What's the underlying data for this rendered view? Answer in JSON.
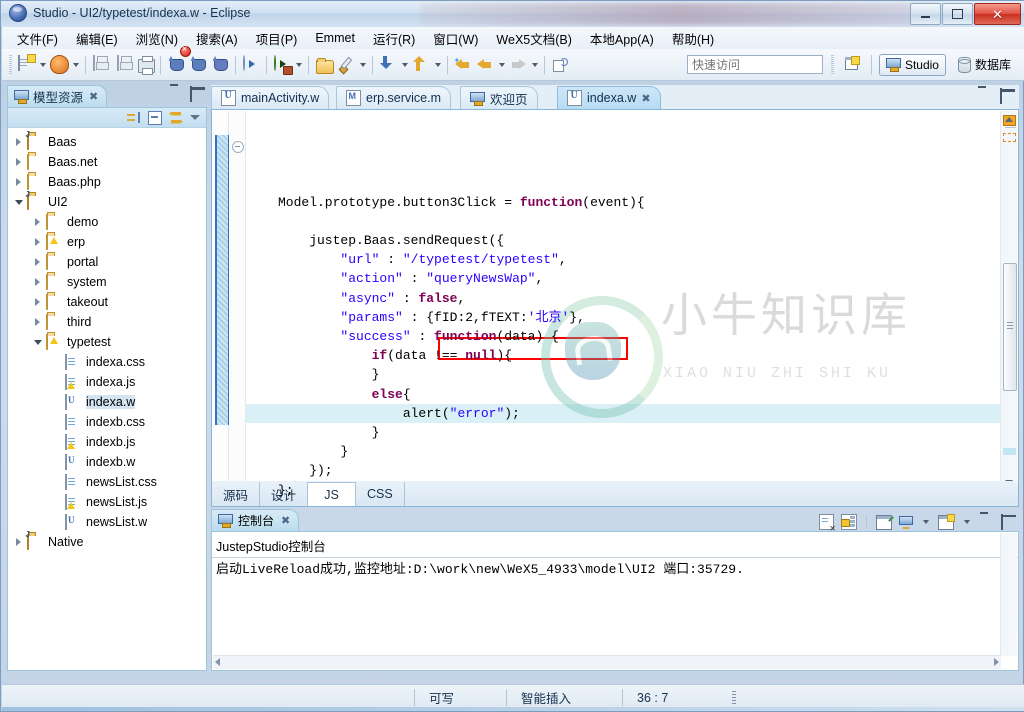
{
  "window": {
    "title": "Studio - UI2/typetest/indexa.w - Eclipse",
    "app_icon": "eclipse-icon",
    "minimize": "minimize-icon",
    "maximize": "maximize-icon",
    "close": "close-icon"
  },
  "menubar": [
    {
      "label": "文件(F)"
    },
    {
      "label": "编辑(E)"
    },
    {
      "label": "浏览(N)"
    },
    {
      "label": "搜索(A)"
    },
    {
      "label": "项目(P)"
    },
    {
      "label": "Emmet"
    },
    {
      "label": "运行(R)"
    },
    {
      "label": "窗口(W)"
    },
    {
      "label": "WeX5文档(B)"
    },
    {
      "label": "本地App(A)"
    },
    {
      "label": "帮助(H)"
    }
  ],
  "toolbar": {
    "items": [
      {
        "name": "new-button",
        "icon": "new-file-icon"
      },
      {
        "name": "new-dropdown",
        "icon": "chevron-down-icon"
      },
      {
        "name": "open-resource-button",
        "icon": "apple-icon"
      },
      {
        "name": "open-resource-dropdown",
        "icon": "chevron-down-icon"
      },
      {
        "name": "save-button",
        "icon": "save-icon"
      },
      {
        "name": "save-all-button",
        "icon": "save-all-icon"
      },
      {
        "name": "print-button",
        "icon": "print-icon"
      },
      {
        "name": "debug-cat-button",
        "icon": "cat-icon"
      },
      {
        "name": "stop-cat-button",
        "icon": "cat-error-icon"
      },
      {
        "name": "browser-cat-button",
        "icon": "cat-blue-icon"
      },
      {
        "name": "run-button",
        "icon": "run-icon"
      },
      {
        "name": "run-as-button",
        "icon": "run-green-icon"
      },
      {
        "name": "run-as-dropdown",
        "icon": "chevron-down-icon"
      },
      {
        "name": "open-folder-button",
        "icon": "folder-open-icon"
      },
      {
        "name": "brush-button",
        "icon": "brush-icon"
      },
      {
        "name": "brush-dropdown",
        "icon": "chevron-down-icon"
      },
      {
        "name": "download-button",
        "icon": "download-icon"
      },
      {
        "name": "download-dropdown",
        "icon": "chevron-down-icon"
      },
      {
        "name": "upload-button",
        "icon": "upload-icon"
      },
      {
        "name": "upload-dropdown",
        "icon": "chevron-down-icon"
      },
      {
        "name": "back-star-button",
        "icon": "back-arrow-star-icon"
      },
      {
        "name": "back-button",
        "icon": "back-arrow-icon"
      },
      {
        "name": "back-dropdown",
        "icon": "chevron-down-icon"
      },
      {
        "name": "forward-button",
        "icon": "forward-arrow-icon"
      },
      {
        "name": "forward-dropdown",
        "icon": "chevron-down-icon"
      },
      {
        "name": "link-button",
        "icon": "link-editor-icon"
      }
    ],
    "quick_access_placeholder": "快速访问",
    "quick_access_value": "",
    "new_perspective_icon": "new-perspective-icon",
    "perspectives": [
      {
        "label": "Studio",
        "icon": "monitor-icon",
        "active": true
      },
      {
        "label": "数据库",
        "icon": "database-icon",
        "active": false
      }
    ]
  },
  "left_view": {
    "tab_label": "模型资源",
    "tab_icon": "monitor-icon",
    "tab_close": "close-icon",
    "minimize_icon": "minimize-icon",
    "maximize_icon": "maximize-icon",
    "toolbar": [
      {
        "name": "collapse-to-selection-button",
        "icon": "collapse-icon"
      },
      {
        "name": "collapse-all-button",
        "icon": "collapse-all-icon"
      },
      {
        "name": "link-with-editor-button",
        "icon": "sync-icon"
      },
      {
        "name": "view-menu-button",
        "icon": "chevron-down-icon"
      }
    ],
    "tree": [
      {
        "label": "Baas",
        "depth": 0,
        "type": "project",
        "state": "collapsed"
      },
      {
        "label": "Baas.net",
        "depth": 0,
        "type": "folder",
        "state": "collapsed"
      },
      {
        "label": "Baas.php",
        "depth": 0,
        "type": "folder",
        "state": "collapsed"
      },
      {
        "label": "UI2",
        "depth": 0,
        "type": "project",
        "state": "expanded"
      },
      {
        "label": "demo",
        "depth": 1,
        "type": "folder",
        "state": "collapsed"
      },
      {
        "label": "erp",
        "depth": 1,
        "type": "folder-warn",
        "state": "collapsed"
      },
      {
        "label": "portal",
        "depth": 1,
        "type": "folder",
        "state": "collapsed"
      },
      {
        "label": "system",
        "depth": 1,
        "type": "folder",
        "state": "collapsed"
      },
      {
        "label": "takeout",
        "depth": 1,
        "type": "folder",
        "state": "collapsed"
      },
      {
        "label": "third",
        "depth": 1,
        "type": "folder",
        "state": "collapsed"
      },
      {
        "label": "typetest",
        "depth": 1,
        "type": "folder-warn",
        "state": "expanded"
      },
      {
        "label": "indexa.css",
        "depth": 2,
        "type": "css",
        "state": "leaf"
      },
      {
        "label": "indexa.js",
        "depth": 2,
        "type": "js",
        "state": "leaf"
      },
      {
        "label": "indexa.w",
        "depth": 2,
        "type": "w",
        "state": "leaf",
        "selected": true
      },
      {
        "label": "indexb.css",
        "depth": 2,
        "type": "css",
        "state": "leaf"
      },
      {
        "label": "indexb.js",
        "depth": 2,
        "type": "js",
        "state": "leaf"
      },
      {
        "label": "indexb.w",
        "depth": 2,
        "type": "w",
        "state": "leaf"
      },
      {
        "label": "newsList.css",
        "depth": 2,
        "type": "css",
        "state": "leaf"
      },
      {
        "label": "newsList.js",
        "depth": 2,
        "type": "js",
        "state": "leaf"
      },
      {
        "label": "newsList.w",
        "depth": 2,
        "type": "w",
        "state": "leaf"
      },
      {
        "label": "Native",
        "depth": 0,
        "type": "project",
        "state": "collapsed"
      }
    ]
  },
  "editor": {
    "tabs": [
      {
        "label": "mainActivity.w",
        "icon": "w-file-icon",
        "active": false,
        "closable": false
      },
      {
        "label": "erp.service.m",
        "icon": "m-file-icon",
        "active": false,
        "closable": false
      },
      {
        "label": "欢迎页",
        "icon": "monitor-icon",
        "active": false,
        "closable": false
      },
      {
        "label": "indexa.w",
        "icon": "w-file-icon",
        "active": true,
        "closable": true
      }
    ],
    "tab_close": "close-icon",
    "minimize_icon": "minimize-icon",
    "maximize_icon": "maximize-icon",
    "code_lines": [
      "Model.prototype.button3Click = function(event){",
      "",
      "    justep.Baas.sendRequest({",
      "        \"url\" : \"/typetest/typetest\",",
      "        \"action\" : \"queryNewsWap\",",
      "        \"async\" : false,",
      "        \"params\" : {fID:2,fTEXT:'北京'},",
      "        \"success\" : function(data) {",
      "            if(data !== null){",
      "            }",
      "            else{",
      "                alert(\"error\");",
      "            }",
      "        }",
      "    });",
      "};"
    ],
    "highlight_annotation": "params-value-highlight",
    "watermark": {
      "cn": "小牛知识库",
      "en": "XIAO NIU ZHI SHI KU"
    },
    "page_tabs": [
      {
        "label": "源码",
        "active": false
      },
      {
        "label": "设计",
        "active": false
      },
      {
        "label": "JS",
        "active": true
      },
      {
        "label": "CSS",
        "active": false
      }
    ]
  },
  "console": {
    "tab_label": "控制台",
    "tab_icon": "console-icon",
    "tab_close": "close-icon",
    "tools": [
      {
        "name": "clear-console-button",
        "icon": "clear-icon"
      },
      {
        "name": "scroll-lock-button",
        "icon": "lock-icon"
      },
      {
        "name": "pin-console-button",
        "icon": "pin-icon"
      },
      {
        "name": "display-selected-console-button",
        "icon": "open-console-icon"
      },
      {
        "name": "display-selected-dropdown",
        "icon": "chevron-down-icon"
      },
      {
        "name": "open-console-button",
        "icon": "new-console-icon"
      },
      {
        "name": "open-console-dropdown",
        "icon": "chevron-down-icon"
      },
      {
        "name": "minimize-button",
        "icon": "minimize-icon"
      },
      {
        "name": "maximize-button",
        "icon": "maximize-icon"
      }
    ],
    "title": "JustepStudio控制台",
    "output": "启动LiveReload成功,监控地址:D:\\work\\new\\WeX5_4933\\model\\UI2 端口:35729."
  },
  "statusbar": {
    "writable": "可写",
    "insert_mode": "智能插入",
    "cursor_position": "36 : 7"
  },
  "colors": {
    "accent": "#2f74c0",
    "annotation": "#ff0000",
    "string": "#2a00ff",
    "keyword": "#7f0055",
    "highlight_line": "#d9f0f6"
  }
}
